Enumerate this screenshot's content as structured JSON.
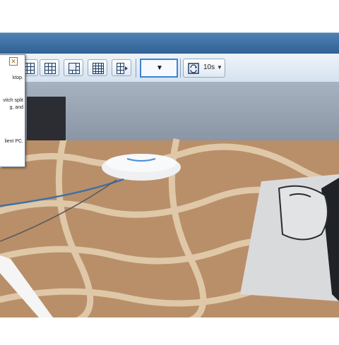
{
  "tooltip": {
    "line1": "ktop.",
    "line2": "vitch split",
    "line3": "g, and",
    "line4": "lient PC."
  },
  "toolbar": {
    "cycle_interval": "10s",
    "dropdown_value": ""
  },
  "icons": {
    "layout_a": "grid-3x3-icon",
    "layout_b": "grid-3x3-icon",
    "layout_c": "grid-mixed-icon",
    "layout_d": "grid-4x4-icon",
    "layout_e": "grid-play-icon",
    "cycle": "cycle-icon",
    "close": "close-icon"
  }
}
